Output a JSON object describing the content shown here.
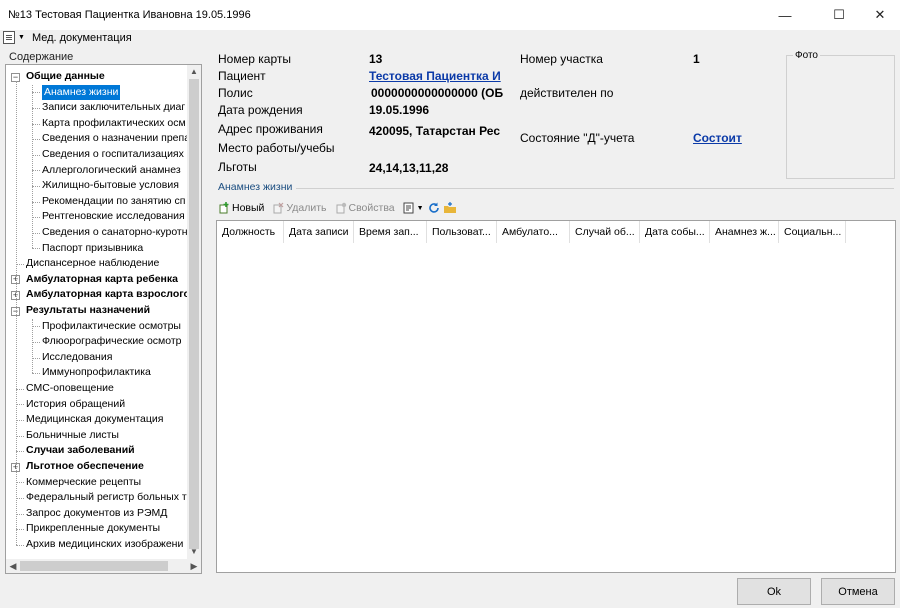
{
  "window": {
    "title": "№13 Тестовая Пациентка Ивановна 19.05.1996",
    "minimize": "—",
    "maximize": "☐",
    "close": "✕"
  },
  "menu": {
    "med_docs": "Мед. документация",
    "med_docs_icon": "document-icon"
  },
  "contents": {
    "label": "Содержание",
    "tree": [
      {
        "label": "Общие данные",
        "level": 0,
        "bold": true,
        "expander": "−"
      },
      {
        "label": "Анамнез жизни",
        "level": 1,
        "selected": true
      },
      {
        "label": "Записи заключительных диаг",
        "level": 1
      },
      {
        "label": "Карта профилактических осм",
        "level": 1
      },
      {
        "label": "Сведения о назначении препа",
        "level": 1
      },
      {
        "label": "Сведения о госпитализациях",
        "level": 1
      },
      {
        "label": "Аллергологический анамнез",
        "level": 1
      },
      {
        "label": "Жилищно-бытовые условия",
        "level": 1
      },
      {
        "label": "Рекомендации по занятию сп",
        "level": 1
      },
      {
        "label": "Рентгеновские исследования",
        "level": 1
      },
      {
        "label": "Сведения о санаторно-куротн",
        "level": 1
      },
      {
        "label": "Паспорт призывника",
        "level": 1
      },
      {
        "label": "Диспансерное наблюдение",
        "level": 0
      },
      {
        "label": "Амбулаторная карта ребенка",
        "level": 0,
        "bold": true,
        "expander": "+"
      },
      {
        "label": "Амбулаторная карта взрослого",
        "level": 0,
        "bold": true,
        "expander": "+"
      },
      {
        "label": "Результаты назначений",
        "level": 0,
        "bold": true,
        "expander": "−"
      },
      {
        "label": "Профилактические осмотры",
        "level": 1
      },
      {
        "label": "Флюорографические осмотр",
        "level": 1
      },
      {
        "label": "Исследования",
        "level": 1
      },
      {
        "label": "Иммунопрофилактика",
        "level": 1
      },
      {
        "label": "СМС-оповещение",
        "level": 0
      },
      {
        "label": "История обращений",
        "level": 0
      },
      {
        "label": "Медицинская документация",
        "level": 0
      },
      {
        "label": "Больничные листы",
        "level": 0
      },
      {
        "label": "Случаи заболеваний",
        "level": 0,
        "bold": true
      },
      {
        "label": "Льготное обеспечение",
        "level": 0,
        "bold": true,
        "expander": "+"
      },
      {
        "label": "Коммерческие рецепты",
        "level": 0
      },
      {
        "label": "Федеральный регистр больных т",
        "level": 0
      },
      {
        "label": "Запрос документов из РЭМД",
        "level": 0
      },
      {
        "label": "Прикрепленные документы",
        "level": 0
      },
      {
        "label": "Архив медицинских изображени",
        "level": 0
      }
    ]
  },
  "patient": {
    "card_label": "Номер карты",
    "card_value": "13",
    "patient_label": "Пациент",
    "patient_value": "Тестовая Пациентка И",
    "policy_label": "Полис",
    "policy_value": "0000000000000000 (ОБ",
    "policy_valid_label": "действителен по",
    "dob_label": "Дата рождения",
    "dob_value": "19.05.1996",
    "address_label": "Адрес проживания",
    "address_value": "420095, Татарстан Рес",
    "work_label": "Место работы/учебы",
    "benefits_label": "Льготы",
    "benefits_value": "24,14,13,11,28",
    "district_label": "Номер участка",
    "district_value": "1",
    "d_status_label": "Состояние \"Д\"-учета",
    "d_status_value": "Состоит",
    "photo_label": "Фото"
  },
  "anamnesis": {
    "group_label": "Анамнез жизни",
    "toolbar": {
      "new": "Новый",
      "delete": "Удалить",
      "props": "Свойства"
    },
    "columns": [
      "Должность",
      "Дата записи",
      "Время зап...",
      "Пользоват...",
      "Амбулато...",
      "Случай об...",
      "Дата собы...",
      "Анамнез ж...",
      "Социальн..."
    ]
  },
  "buttons": {
    "ok": "Ok",
    "cancel": "Отмена"
  },
  "colors": {
    "selection": "#0078d7",
    "link": "#0b3aa8",
    "group_label": "#1a4d80"
  }
}
